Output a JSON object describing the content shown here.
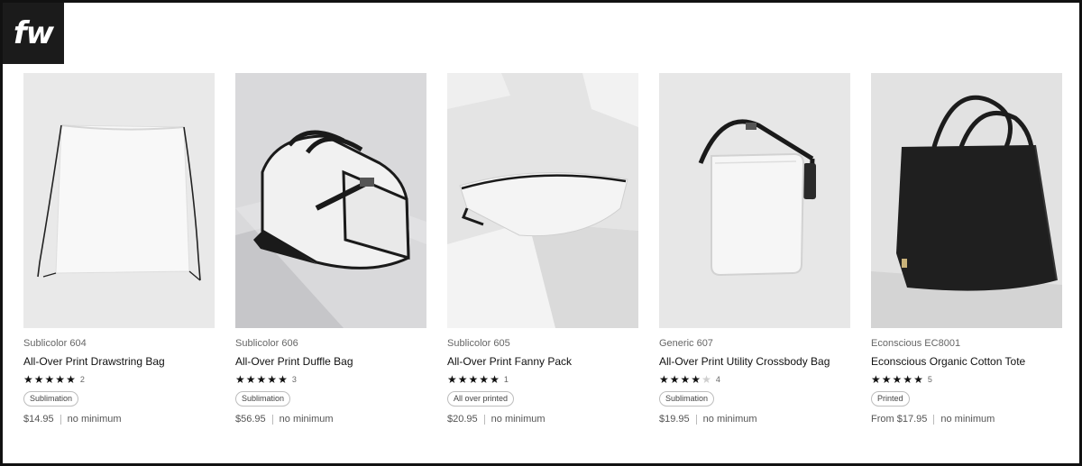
{
  "logo": {
    "text": "fw"
  },
  "products": [
    {
      "brand": "Sublicolor 604",
      "title": "All-Over Print Drawstring Bag",
      "rating": 5,
      "review_count": "2",
      "tag": "Sublimation",
      "price": "$14.95",
      "minimum": "no minimum",
      "image_icon": "drawstring-bag-image"
    },
    {
      "brand": "Sublicolor 606",
      "title": "All-Over Print Duffle Bag",
      "rating": 5,
      "review_count": "3",
      "tag": "Sublimation",
      "price": "$56.95",
      "minimum": "no minimum",
      "image_icon": "duffle-bag-image"
    },
    {
      "brand": "Sublicolor 605",
      "title": "All-Over Print Fanny Pack",
      "rating": 5,
      "review_count": "1",
      "tag": "All over printed",
      "price": "$20.95",
      "minimum": "no minimum",
      "image_icon": "fanny-pack-image"
    },
    {
      "brand": "Generic 607",
      "title": "All-Over Print Utility Crossbody Bag",
      "rating": 4,
      "review_count": "4",
      "tag": "Sublimation",
      "price": "$19.95",
      "minimum": "no minimum",
      "image_icon": "crossbody-bag-image"
    },
    {
      "brand": "Econscious EC8001",
      "title": "Econscious Organic Cotton Tote",
      "rating": 5,
      "review_count": "5",
      "tag": "Printed",
      "price": "From $17.95",
      "minimum": "no minimum",
      "image_icon": "tote-bag-image"
    }
  ],
  "star_glyph": "★",
  "star_count": 5
}
